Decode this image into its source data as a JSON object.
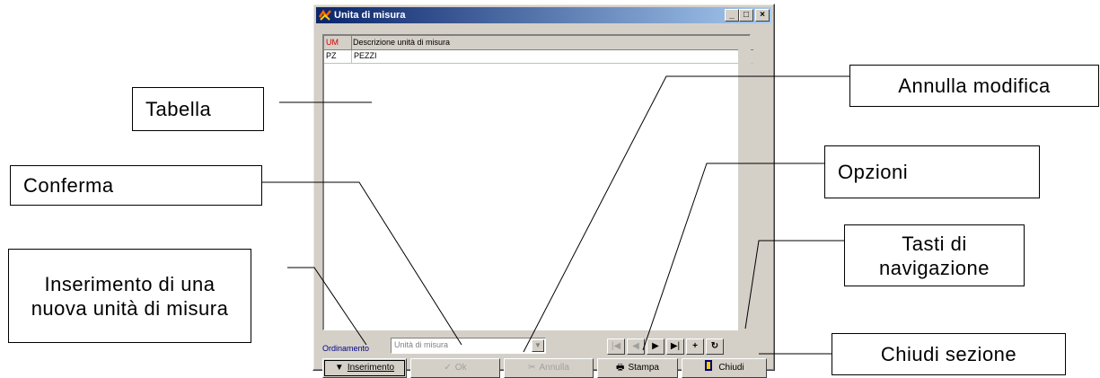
{
  "window": {
    "title": "Unita di misura",
    "title_buttons": {
      "minimize": "_",
      "maximize": "□",
      "close": "×"
    }
  },
  "grid": {
    "columns": [
      "UM",
      "Descrizione unità di misura"
    ],
    "rows": [
      [
        "PZ",
        "PEZZI"
      ]
    ]
  },
  "ordering": {
    "label": "Ordinamento",
    "selected": "Unità di misura"
  },
  "navigation": {
    "first": "|◀",
    "prev": "◀",
    "next": "▶",
    "last": "▶|",
    "add": "+",
    "refresh": "↻"
  },
  "buttons": {
    "insert": "Inserimento",
    "ok": "Ok",
    "cancel": "Annulla",
    "print": "Stampa",
    "close": "Chiudi"
  },
  "callouts": {
    "tabella": "Tabella",
    "conferma": "Conferma",
    "inserimento": "Inserimento di una nuova unità di misura",
    "annulla_modifica": "Annulla modifica",
    "opzioni": "Opzioni",
    "tasti_navigazione": "Tasti di navigazione",
    "chiudi_sezione": "Chiudi sezione"
  },
  "colors": {
    "titlebar_start": "#0a246a",
    "titlebar_end": "#a6caf0",
    "header_um": "#d00000",
    "ordering_label": "#000080"
  },
  "icons": [
    "app-icon",
    "check-icon",
    "scissors-icon",
    "printer-icon",
    "door-icon",
    "arrow-down-icon"
  ]
}
